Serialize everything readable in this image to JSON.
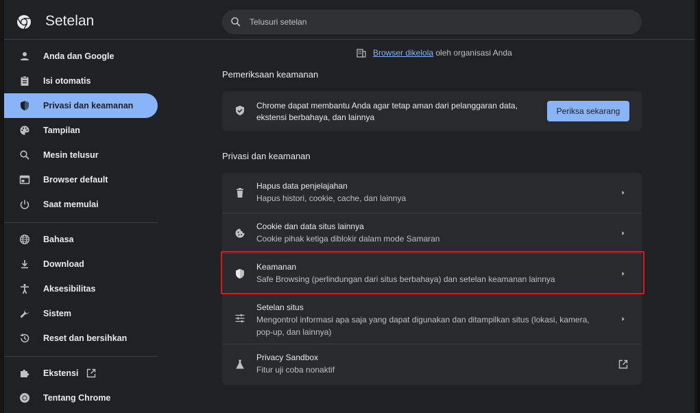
{
  "app": {
    "title": "Setelan"
  },
  "search": {
    "placeholder": "Telusuri setelan"
  },
  "sidebar": {
    "items": [
      {
        "label": "Anda dan Google",
        "icon": "person-icon"
      },
      {
        "label": "Isi otomatis",
        "icon": "clipboard-icon"
      },
      {
        "label": "Privasi dan keamanan",
        "icon": "shield-icon",
        "active": true
      },
      {
        "label": "Tampilan",
        "icon": "palette-icon"
      },
      {
        "label": "Mesin telusur",
        "icon": "search-icon"
      },
      {
        "label": "Browser default",
        "icon": "browser-icon"
      },
      {
        "label": "Saat memulai",
        "icon": "power-icon"
      },
      {
        "label": "Bahasa",
        "icon": "globe-icon"
      },
      {
        "label": "Download",
        "icon": "download-icon"
      },
      {
        "label": "Aksesibilitas",
        "icon": "accessibility-icon"
      },
      {
        "label": "Sistem",
        "icon": "wrench-icon"
      },
      {
        "label": "Reset dan bersihkan",
        "icon": "history-icon"
      },
      {
        "label": "Ekstensi",
        "icon": "puzzle-icon"
      },
      {
        "label": "Tentang Chrome",
        "icon": "chrome-icon"
      }
    ]
  },
  "main": {
    "managed": {
      "link": "Browser dikelola",
      "suffix": " oleh organisasi Anda"
    },
    "safety_check": {
      "title": "Pemeriksaan keamanan",
      "description": "Chrome dapat membantu Anda agar tetap aman dari pelanggaran data, ekstensi berbahaya, dan lainnya",
      "button": "Periksa sekarang"
    },
    "privacy": {
      "title": "Privasi dan keamanan",
      "rows": [
        {
          "title": "Hapus data penjelajahan",
          "subtitle": "Hapus histori, cookie, cache, dan lainnya",
          "icon": "trash-icon"
        },
        {
          "title": "Cookie dan data situs lainnya",
          "subtitle": "Cookie pihak ketiga diblokir dalam mode Samaran",
          "icon": "cookie-icon"
        },
        {
          "title": "Keamanan",
          "subtitle": "Safe Browsing (perlindungan dari situs berbahaya) dan setelan keamanan lainnya",
          "icon": "shield-icon",
          "highlighted": true
        },
        {
          "title": "Setelan situs",
          "subtitle": "Mengontrol informasi apa saja yang dapat digunakan dan ditampilkan situs (lokasi, kamera, pop-up, dan lainnya)",
          "icon": "sliders-icon"
        },
        {
          "title": "Privacy Sandbox",
          "subtitle": "Fitur uji coba nonaktif",
          "icon": "flask-icon"
        }
      ]
    }
  },
  "colors": {
    "accent": "#8ab4f8",
    "highlight_border": "#e5141e",
    "background": "#202124",
    "card": "#292a2d"
  }
}
